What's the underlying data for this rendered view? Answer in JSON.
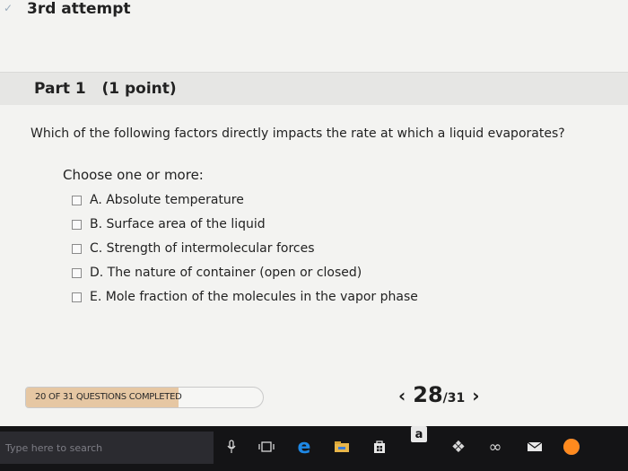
{
  "header": {
    "attempt_title": "3rd attempt"
  },
  "part": {
    "label": "Part 1   (1 point)"
  },
  "question": {
    "text": "Which of the following factors directly impacts the rate at which a liquid evaporates?",
    "instruction": "Choose one or more:",
    "options": [
      {
        "label": "A. Absolute temperature",
        "checked": false
      },
      {
        "label": "B. Surface area of the liquid",
        "checked": false
      },
      {
        "label": "C. Strength of intermolecular forces",
        "checked": false
      },
      {
        "label": "D. The nature of container (open or closed)",
        "checked": false
      },
      {
        "label": "E. Mole fraction of the molecules in the vapor phase",
        "checked": false
      }
    ]
  },
  "footer": {
    "progress_text": "20 OF 31 QUESTIONS COMPLETED",
    "progress_fraction": 0.645,
    "current_page": "28",
    "total_pages": "/31",
    "prev_icon": "chevron-left-icon",
    "next_icon": "chevron-right-icon"
  },
  "taskbar": {
    "search_placeholder": "Type here to search",
    "icons": [
      "microphone-icon",
      "task-view-icon",
      "edge-icon",
      "file-explorer-icon",
      "store-icon",
      "amazon-icon",
      "dropbox-icon",
      "infinity-icon",
      "mail-icon",
      "firefox-icon"
    ]
  },
  "colors": {
    "progress_fill": "#e6c7a3",
    "taskbar": "#141416",
    "edge": "#1e88e5",
    "firefox": "#ff8a1e"
  }
}
